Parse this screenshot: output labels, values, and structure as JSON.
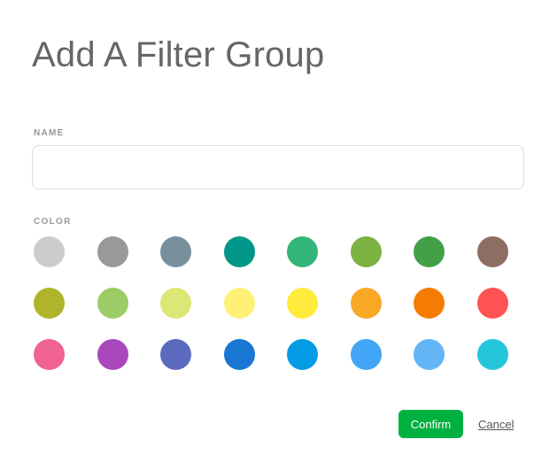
{
  "dialog": {
    "title": "Add A Filter Group",
    "name_label": "NAME",
    "name_value": "",
    "color_label": "COLOR",
    "colors": [
      "#cccccc",
      "#999999",
      "#78909c",
      "#009688",
      "#33b679",
      "#7cb342",
      "#43a047",
      "#8d6e63",
      "#afb42b",
      "#9ccc65",
      "#dce775",
      "#fff176",
      "#ffeb3b",
      "#f9a825",
      "#f57c00",
      "#ff5252",
      "#f06292",
      "#ab47bc",
      "#5c6bc0",
      "#1976d2",
      "#039be5",
      "#42a5f5",
      "#64b5f6",
      "#26c6da"
    ],
    "confirm_label": "Confirm",
    "cancel_label": "Cancel"
  },
  "theme": {
    "accent": "#00b140",
    "title_color": "#666666",
    "label_color": "#999999"
  }
}
